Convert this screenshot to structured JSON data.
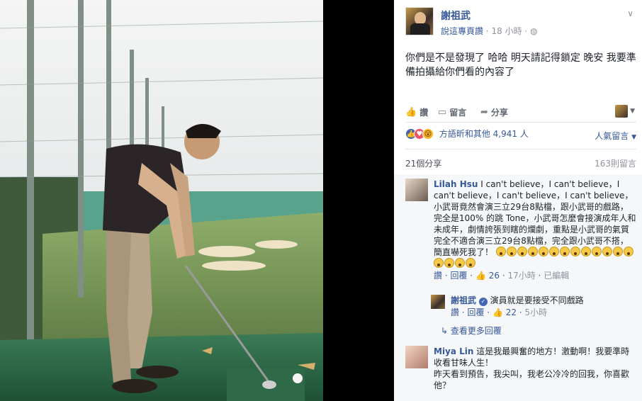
{
  "post": {
    "page_name": "謝祖武",
    "meta_link": "說這專頁讚",
    "meta_sep": "·",
    "meta_time": "18 小時",
    "meta_privacy_icon": "globe-icon",
    "options_icon": "chevron-down-icon",
    "text": "你們是不是發現了 哈哈 明天請記得鎖定 晚安 我要準備拍攝給你們看的內容了"
  },
  "actions": {
    "like_label": "讚",
    "comment_label": "留言",
    "share_label": "分享",
    "select_caret": "▼"
  },
  "reactions": {
    "like_glyph": "👍",
    "love_glyph": "♥",
    "wow_glyph": "😮",
    "names": "方語昕和其他 4,941 人",
    "top_comments_label": "人氣留言",
    "top_comments_caret": "▼"
  },
  "counts": {
    "shares": "21個分享",
    "comments": "163則留言"
  },
  "comments": [
    {
      "author": "Lilah Hsu",
      "text": "I can't believe，I can't believe，I can't believe，I can't believe，I can't believe，小武哥竟然會演三立29台8點檔，跟小武哥的戲路，完全是100% 的跳 Tone，小武哥怎麼會接演成年人和未成年，劇情誇張到瞎的爛劇，重點是小武哥的氣質完全不適合演三立29台8點檔，完全跟小武哥不搭，簡直嚇死我了！",
      "like": "讚",
      "reply": "回覆",
      "likes": "26",
      "time": "17小時",
      "edited": "已編輯"
    },
    {
      "author": "Miya Lin",
      "text": "這是我最興奮的地方！激動啊！我要準時收看甘味人生！",
      "text2": "昨天看到預告，我尖叫，我老公冷冷的回我，你喜歡他？"
    }
  ],
  "reply": {
    "author": "謝祖武",
    "verified_glyph": "✓",
    "text": "演員就是要接受不同戲路",
    "like": "讚",
    "reply": "回覆",
    "likes": "22",
    "time": "5小時"
  },
  "more_replies": "查看更多回覆",
  "colors": {
    "link": "#365899",
    "accent": "#4267b2",
    "muted": "#90949c"
  }
}
